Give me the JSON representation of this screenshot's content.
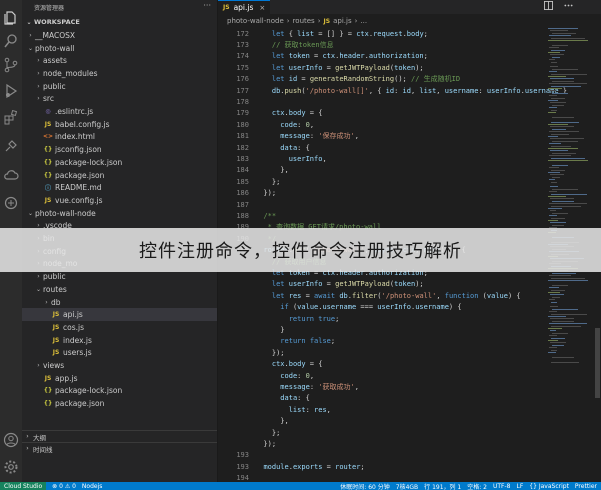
{
  "sidebar": {
    "title": "资源管理器",
    "more": "···",
    "workspace": "WORKSPACE",
    "items": [
      {
        "label": "__MACOSX",
        "depth": 1,
        "kind": "folder",
        "open": false
      },
      {
        "label": "photo-wall",
        "depth": 1,
        "kind": "folder",
        "open": true
      },
      {
        "label": "assets",
        "depth": 2,
        "kind": "folder",
        "open": false
      },
      {
        "label": "node_modules",
        "depth": 2,
        "kind": "folder",
        "open": false
      },
      {
        "label": "public",
        "depth": 2,
        "kind": "folder",
        "open": false
      },
      {
        "label": "src",
        "depth": 2,
        "kind": "folder",
        "open": false
      },
      {
        "label": ".eslintrc.js",
        "depth": 2,
        "kind": "eslint"
      },
      {
        "label": "babel.config.js",
        "depth": 2,
        "kind": "babel"
      },
      {
        "label": "index.html",
        "depth": 2,
        "kind": "html"
      },
      {
        "label": "jsconfig.json",
        "depth": 2,
        "kind": "json"
      },
      {
        "label": "package-lock.json",
        "depth": 2,
        "kind": "json"
      },
      {
        "label": "package.json",
        "depth": 2,
        "kind": "json"
      },
      {
        "label": "README.md",
        "depth": 2,
        "kind": "info"
      },
      {
        "label": "vue.config.js",
        "depth": 2,
        "kind": "js"
      },
      {
        "label": "photo-wall-node",
        "depth": 1,
        "kind": "folder",
        "open": true
      },
      {
        "label": ".vscode",
        "depth": 2,
        "kind": "folder",
        "open": false
      },
      {
        "label": "bin",
        "depth": 2,
        "kind": "folder",
        "open": false
      },
      {
        "label": "config",
        "depth": 2,
        "kind": "folder",
        "open": false
      },
      {
        "label": "node_mo",
        "depth": 2,
        "kind": "folder",
        "open": false
      },
      {
        "label": "public",
        "depth": 2,
        "kind": "folder",
        "open": false
      },
      {
        "label": "routes",
        "depth": 2,
        "kind": "folder",
        "open": true
      },
      {
        "label": "db",
        "depth": 3,
        "kind": "folder",
        "open": false
      },
      {
        "label": "api.js",
        "depth": 3,
        "kind": "js",
        "selected": true
      },
      {
        "label": "cos.js",
        "depth": 3,
        "kind": "js"
      },
      {
        "label": "index.js",
        "depth": 3,
        "kind": "js"
      },
      {
        "label": "users.js",
        "depth": 3,
        "kind": "js"
      },
      {
        "label": "views",
        "depth": 2,
        "kind": "folder",
        "open": false
      },
      {
        "label": "app.js",
        "depth": 2,
        "kind": "js"
      },
      {
        "label": "package-lock.json",
        "depth": 2,
        "kind": "json"
      },
      {
        "label": "package.json",
        "depth": 2,
        "kind": "json"
      }
    ],
    "outline": "大纲",
    "timeline": "时间线"
  },
  "tab": {
    "icon": "JS",
    "label": "api.js",
    "close": "×"
  },
  "breadcrumb": {
    "part1": "photo-wall-node",
    "part2": "routes",
    "icon": "JS",
    "part3": "api.js",
    "part4": "..."
  },
  "code_lines": [
    {
      "n": "172",
      "html": "    <span class='kw'>let</span> { <span class='var'>list</span> = [] } = <span class='var'>ctx</span>.<span class='var'>request</span>.<span class='var'>body</span>;"
    },
    {
      "n": "173",
      "html": "    <span class='cm'>// 获取token信息</span>"
    },
    {
      "n": "174",
      "html": "    <span class='kw'>let</span> <span class='var'>token</span> = <span class='var'>ctx</span>.<span class='var'>header</span>.<span class='var'>authorization</span>;"
    },
    {
      "n": "175",
      "html": "    <span class='kw'>let</span> <span class='var'>userInfo</span> = <span class='fn'>getJWTPayload</span>(<span class='var'>token</span>);"
    },
    {
      "n": "176",
      "html": "    <span class='kw'>let</span> <span class='var'>id</span> = <span class='fn'>generateRandomString</span>(); <span class='cm'>// 生成随机ID</span>"
    },
    {
      "n": "177",
      "html": "    <span class='var'>db</span>.<span class='fn'>push</span>(<span class='str'>'/photo-wall[]'</span>, { <span class='var'>id</span>: <span class='var'>id</span>, <span class='var'>list</span>, <span class='var'>username</span>: <span class='var'>userInfo</span>.<span class='var'>username</span> }"
    },
    {
      "n": "178",
      "html": ""
    },
    {
      "n": "179",
      "html": "    <span class='var'>ctx</span>.<span class='var'>body</span> = {"
    },
    {
      "n": "180",
      "html": "      <span class='var'>code</span>: <span class='num'>0</span>,"
    },
    {
      "n": "181",
      "html": "      <span class='var'>message</span>: <span class='str'>'保存成功'</span>,"
    },
    {
      "n": "182",
      "html": "      <span class='var'>data</span>: {"
    },
    {
      "n": "183",
      "html": "        <span class='var'>userInfo</span>,"
    },
    {
      "n": "184",
      "html": "      },"
    },
    {
      "n": "185",
      "html": "    };"
    },
    {
      "n": "186",
      "html": "  });"
    },
    {
      "n": "187",
      "html": ""
    },
    {
      "n": "188",
      "html": "  <span class='cm'>/**</span>"
    },
    {
      "n": "189",
      "html": "  <span class='cm'> * 查询数据 GET请求/photo-wall</span>"
    },
    {
      "n": "190",
      "html": "  <span class='cm'> */</span>"
    },
    {
      "n": "191",
      "html": "  <span class='var'>router</span>.<span class='fn'>get</span>(<span class='str'>'/photo-wall'</span>, <span class='kw'>async</span> (<span class='var'>ctx</span>, <span class='var'>next</span>) =&gt; {"
    },
    {
      "n": "",
      "html": "    <span class='cm'>// 获取用户信息</span>"
    },
    {
      "n": "",
      "html": "    <span class='kw'>let</span> <span class='var'>token</span> = <span class='var'>ctx</span>.<span class='var'>header</span>.<span class='var'>authorization</span>;"
    },
    {
      "n": "",
      "html": "    <span class='kw'>let</span> <span class='var'>userInfo</span> = <span class='fn'>getJWTPayload</span>(<span class='var'>token</span>);"
    },
    {
      "n": "",
      "html": "    <span class='kw'>let</span> <span class='var'>res</span> = <span class='kw'>await</span> <span class='var'>db</span>.<span class='fn'>filter</span>(<span class='str'>'/photo-wall'</span>, <span class='kw'>function</span> (<span class='var'>value</span>) {"
    },
    {
      "n": "",
      "html": "      <span class='kw'>if</span> (<span class='var'>value</span>.<span class='var'>username</span> === <span class='var'>userInfo</span>.<span class='var'>username</span>) {"
    },
    {
      "n": "",
      "html": "        <span class='kw'>return</span> <span class='kw'>true</span>;"
    },
    {
      "n": "",
      "html": "      }"
    },
    {
      "n": "",
      "html": "      <span class='kw'>return</span> <span class='kw'>false</span>;"
    },
    {
      "n": "",
      "html": "    });"
    },
    {
      "n": "",
      "html": "    <span class='var'>ctx</span>.<span class='var'>body</span> = {"
    },
    {
      "n": "",
      "html": "      <span class='var'>code</span>: <span class='num'>0</span>,"
    },
    {
      "n": "",
      "html": "      <span class='var'>message</span>: <span class='str'>'获取成功'</span>,"
    },
    {
      "n": "",
      "html": "      <span class='var'>data</span>: {"
    },
    {
      "n": "",
      "html": "        <span class='var'>list</span>: <span class='var'>res</span>,"
    },
    {
      "n": "",
      "html": "      },"
    },
    {
      "n": "",
      "html": "    };"
    },
    {
      "n": "",
      "html": "  });"
    },
    {
      "n": "193",
      "html": ""
    },
    {
      "n": "193",
      "html": "  <span class='var'>module</span>.<span class='var'>exports</span> = <span class='var'>router</span>;"
    },
    {
      "n": "194",
      "html": ""
    }
  ],
  "statusbar": {
    "remote": "Cloud Studio",
    "problems": "⊗ 0 ⚠ 0",
    "branch": "Nodejs",
    "right1": "休眠时间: 60 分钟",
    "right2": "7核4GB",
    "right3": "行 191，列 1",
    "right4": "空格: 2",
    "right5": "UTF-8",
    "right6": "LF",
    "right7": "{} JavaScript",
    "right8": "Prettier"
  },
  "overlay": {
    "text": "控件注册命令，控件命令注册技巧解析"
  },
  "colors": {
    "accent": "#007acc",
    "tab_border": "#0078d4",
    "selection": "#37373d",
    "js_icon": "#dcbf3a"
  },
  "icons": {
    "activity": [
      "files-icon",
      "search-icon",
      "source-control-icon",
      "run-debug-icon",
      "extensions-icon",
      "remote-icon",
      "cloud-icon",
      "account-icon",
      "settings-gear-icon"
    ],
    "file_types": {
      "folder": "chevron-icon",
      "js": "JS",
      "json": "{}",
      "html": "html-icon",
      "eslint": "eslint-icon",
      "babel": "babel-icon",
      "info": "info-icon"
    }
  }
}
